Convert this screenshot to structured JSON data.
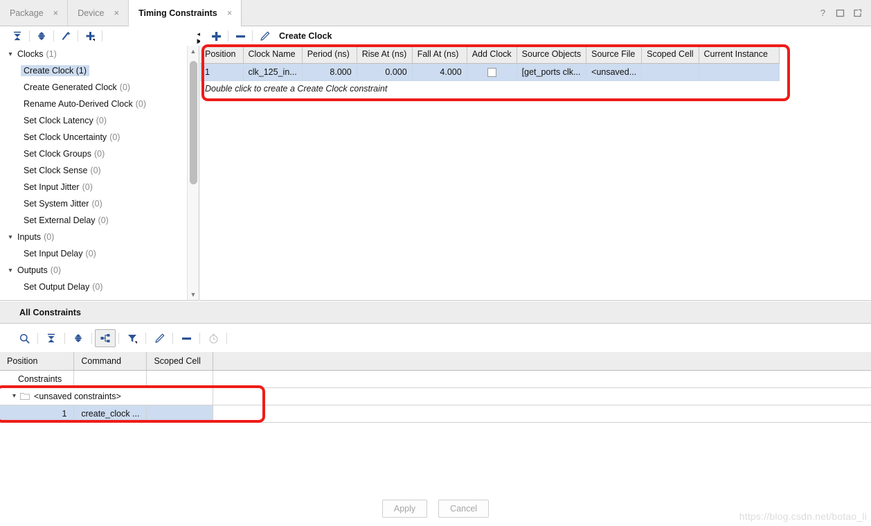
{
  "window": {
    "help_icon": "question-mark-icon",
    "maximize_icon": "maximize-icon",
    "float_icon": "float-window-icon"
  },
  "tabs": [
    {
      "label": "Package",
      "active": false,
      "close": "×"
    },
    {
      "label": "Device",
      "active": false,
      "close": "×"
    },
    {
      "label": "Timing Constraints",
      "active": true,
      "close": "×"
    }
  ],
  "left_toolbar": {
    "buttons": [
      {
        "name": "collapse-all-icon",
        "tooltip": "Collapse All"
      },
      {
        "name": "expand-all-icon",
        "tooltip": "Expand All"
      },
      {
        "name": "magic-wand-icon",
        "tooltip": "Auto Constrain"
      },
      {
        "name": "add-constraint-icon",
        "tooltip": "Add Constraint"
      }
    ]
  },
  "tree": {
    "groups": [
      {
        "label": "Clocks",
        "count": "(1)",
        "expanded": true,
        "items": [
          {
            "label": "Create Clock",
            "count": "(1)",
            "selected": true
          },
          {
            "label": "Create Generated Clock",
            "count": "(0)",
            "selected": false
          },
          {
            "label": "Rename Auto-Derived Clock",
            "count": "(0)",
            "selected": false
          },
          {
            "label": "Set Clock Latency",
            "count": "(0)",
            "selected": false
          },
          {
            "label": "Set Clock Uncertainty",
            "count": "(0)",
            "selected": false
          },
          {
            "label": "Set Clock Groups",
            "count": "(0)",
            "selected": false
          },
          {
            "label": "Set Clock Sense",
            "count": "(0)",
            "selected": false
          },
          {
            "label": "Set Input Jitter",
            "count": "(0)",
            "selected": false
          },
          {
            "label": "Set System Jitter",
            "count": "(0)",
            "selected": false
          },
          {
            "label": "Set External Delay",
            "count": "(0)",
            "selected": false
          }
        ]
      },
      {
        "label": "Inputs",
        "count": "(0)",
        "expanded": true,
        "items": [
          {
            "label": "Set Input Delay",
            "count": "(0)",
            "selected": false
          }
        ]
      },
      {
        "label": "Outputs",
        "count": "(0)",
        "expanded": true,
        "items": [
          {
            "label": "Set Output Delay",
            "count": "(0)",
            "selected": false
          }
        ]
      }
    ]
  },
  "main": {
    "toolbar": {
      "add_icon": "plus-icon",
      "remove_icon": "minus-icon",
      "edit_icon": "pencil-icon",
      "title": "Create Clock"
    },
    "columns": [
      "Position",
      "Clock Name",
      "Period (ns)",
      "Rise At (ns)",
      "Fall At (ns)",
      "Add Clock",
      "Source Objects",
      "Source File",
      "Scoped Cell",
      "Current Instance"
    ],
    "rows": [
      {
        "position": "1",
        "clock_name": "clk_125_in...",
        "period": "8.000",
        "rise_at": "0.000",
        "fall_at": "4.000",
        "add_clock": false,
        "source_objects": "[get_ports clk...",
        "source_file": "<unsaved...",
        "scoped_cell": "",
        "current_instance": "",
        "selected": true
      }
    ],
    "hint": "Double click to create a Create Clock constraint"
  },
  "all_constraints": {
    "title": "All Constraints",
    "toolbar": [
      {
        "name": "search-icon",
        "active": false,
        "disabled": false
      },
      {
        "name": "collapse-all-icon",
        "active": false,
        "disabled": false
      },
      {
        "name": "expand-all-icon",
        "active": false,
        "disabled": false
      },
      {
        "name": "tree-view-icon",
        "active": true,
        "disabled": false
      },
      {
        "name": "filter-icon",
        "active": false,
        "disabled": false
      },
      {
        "name": "pencil-icon",
        "active": false,
        "disabled": false
      },
      {
        "name": "minus-icon",
        "active": false,
        "disabled": false
      },
      {
        "name": "timer-icon",
        "active": false,
        "disabled": true
      }
    ],
    "columns": [
      "Position",
      "Command",
      "Scoped Cell"
    ],
    "subheader": "Constraints",
    "folder": {
      "label": "<unsaved constraints>",
      "icon": "folder-icon",
      "expanded": true
    },
    "rows": [
      {
        "position": "1",
        "command": "create_clock ...",
        "scoped_cell": "",
        "selected": true
      }
    ]
  },
  "buttons": {
    "apply": "Apply",
    "cancel": "Cancel"
  },
  "watermark": "https://blog.csdn.net/botao_li",
  "colors": {
    "selection": "#cddcf0",
    "header": "#ededed",
    "annotation": "#ee1c18",
    "icon": "#2b5496"
  }
}
